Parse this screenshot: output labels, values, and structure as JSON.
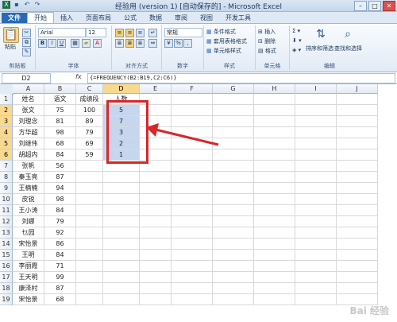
{
  "window": {
    "title": "经验用 (version 1) [自动保存的] - Microsoft Excel"
  },
  "ribbon_tabs": [
    {
      "label": "文件"
    },
    {
      "label": "开始"
    },
    {
      "label": "插入"
    },
    {
      "label": "页面布局"
    },
    {
      "label": "公式"
    },
    {
      "label": "数据"
    },
    {
      "label": "审阅"
    },
    {
      "label": "视图"
    },
    {
      "label": "开发工具"
    }
  ],
  "ribbon": {
    "paste": "粘贴",
    "clipboard": "剪贴板",
    "font_name": "Arial",
    "font_size": "12",
    "bold": "B",
    "italic": "I",
    "underline": "U",
    "font": "字体",
    "alignment": "对齐方式",
    "number_format": "常规",
    "number": "数字",
    "cond_format": "条件格式",
    "table_format": "套用表格格式",
    "cell_style": "单元格样式",
    "styles": "样式",
    "insert": "插入",
    "delete": "删除",
    "format": "格式",
    "cells": "单元格",
    "sort_filter": "排序和筛选",
    "find_select": "查找和选择",
    "editing": "编辑"
  },
  "formula_bar": {
    "name_box": "D2",
    "fx": "fx",
    "formula": "{=FREQUENCY(B2:B19,C2:C6)}"
  },
  "columns": [
    "A",
    "B",
    "C",
    "D",
    "E",
    "F",
    "G",
    "H",
    "I",
    "J"
  ],
  "rows": [
    {
      "num": "1",
      "A": "姓名",
      "B": "语文",
      "C": "成绩段",
      "D": "人数"
    },
    {
      "num": "2",
      "A": "张文",
      "B": "75",
      "C": "100",
      "D": "5"
    },
    {
      "num": "3",
      "A": "刘理念",
      "B": "81",
      "C": "89",
      "D": "7"
    },
    {
      "num": "4",
      "A": "方华超",
      "B": "98",
      "C": "79",
      "D": "3"
    },
    {
      "num": "5",
      "A": "刘继伟",
      "B": "68",
      "C": "69",
      "D": "2"
    },
    {
      "num": "6",
      "A": "胡超内",
      "B": "84",
      "C": "59",
      "D": "1"
    },
    {
      "num": "7",
      "A": "张帆",
      "B": "56",
      "C": "",
      "D": ""
    },
    {
      "num": "8",
      "A": "秦玉亮",
      "B": "87",
      "C": "",
      "D": ""
    },
    {
      "num": "9",
      "A": "王楠楠",
      "B": "94",
      "C": "",
      "D": ""
    },
    {
      "num": "10",
      "A": "皮锐",
      "B": "98",
      "C": "",
      "D": ""
    },
    {
      "num": "11",
      "A": "王小涛",
      "B": "84",
      "C": "",
      "D": ""
    },
    {
      "num": "12",
      "A": "刘娜",
      "B": "79",
      "C": "",
      "D": ""
    },
    {
      "num": "13",
      "A": "乜园",
      "B": "92",
      "C": "",
      "D": ""
    },
    {
      "num": "14",
      "A": "宋怡景",
      "B": "86",
      "C": "",
      "D": ""
    },
    {
      "num": "15",
      "A": "王明",
      "B": "84",
      "C": "",
      "D": ""
    },
    {
      "num": "16",
      "A": "李丽霞",
      "B": "71",
      "C": "",
      "D": ""
    },
    {
      "num": "17",
      "A": "王天明",
      "B": "99",
      "C": "",
      "D": ""
    },
    {
      "num": "18",
      "A": "康泽村",
      "B": "87",
      "C": "",
      "D": ""
    },
    {
      "num": "19",
      "A": "宋怡景",
      "B": "68",
      "C": "",
      "D": ""
    }
  ],
  "watermark": "Bai 经验"
}
